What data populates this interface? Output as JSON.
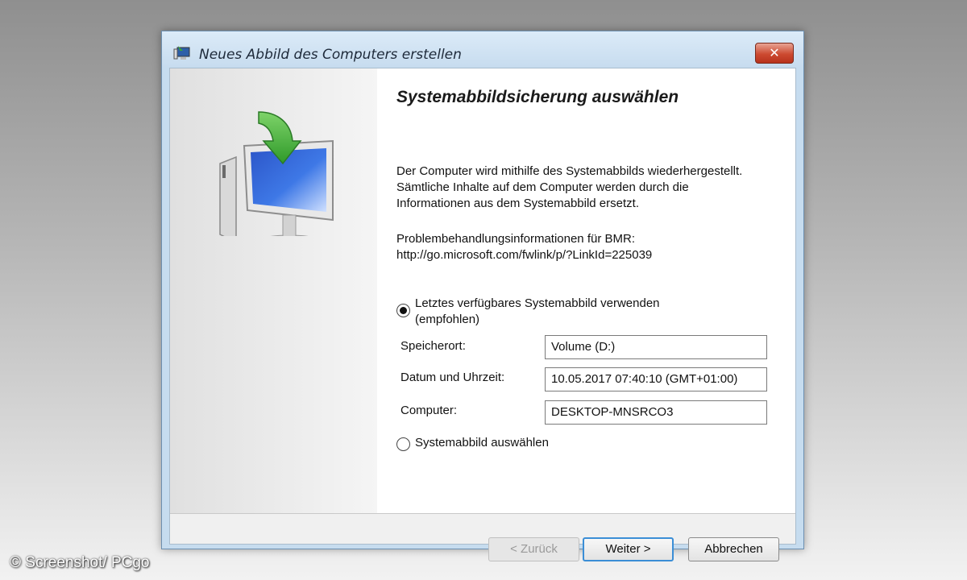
{
  "window": {
    "title": "Neues Abbild des Computers erstellen",
    "close_label": "✕"
  },
  "main": {
    "heading": "Systemabbildsicherung auswählen",
    "description": "Der Computer wird mithilfe des Systemabbilds wiederhergestellt. Sämtliche Inhalte auf dem Computer werden durch die Informationen aus dem Systemabbild ersetzt.",
    "troubleshoot_line1": "Problembehandlungsinformationen für BMR:",
    "troubleshoot_line2": "http://go.microsoft.com/fwlink/p/?LinkId=225039",
    "option_latest_line1": "Letztes verfügbares Systemabbild verwenden",
    "option_latest_line2": "(empfohlen)",
    "option_latest_selected": true,
    "fields": {
      "location_label": "Speicherort:",
      "location_value": "Volume (D:)",
      "datetime_label": "Datum und Uhrzeit:",
      "datetime_value": "10.05.2017 07:40:10 (GMT+01:00)",
      "computer_label": "Computer:",
      "computer_value": "DESKTOP-MNSRCO3"
    },
    "option_select": "Systemabbild auswählen",
    "option_select_selected": false
  },
  "buttons": {
    "back": "< Zurück",
    "next": "Weiter >",
    "cancel": "Abbrechen"
  },
  "watermark": "© Screenshot/ PCgo",
  "icons": {
    "app": "backup-computer-icon",
    "art": "computer-restore-arrow-icon"
  }
}
